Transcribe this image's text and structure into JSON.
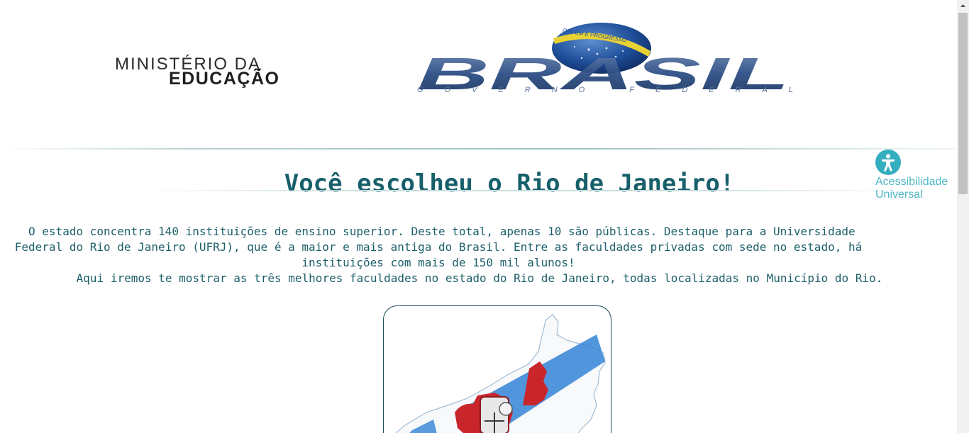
{
  "header": {
    "ministry_line1": "MINISTÉRIO DA",
    "ministry_line2": "EDUCAÇÃO",
    "gov_logo_word": "BRASIL",
    "gov_logo_tagline": "GOVERNO FEDERAL",
    "gov_logo_band": "ORDEM E PROGRESSO"
  },
  "title": "Você escolheu o Rio de Janeiro!",
  "accessibility": {
    "label_line1": "Acessibilidade",
    "label_line2": "Universal",
    "icon": "accessibility-person-icon"
  },
  "intro": {
    "line1": " O estado concentra 140 instituições de ensino superior. Deste total, apenas 10 são públicas. Destaque para a Universidade",
    "line2": "Federal do Rio de Janeiro (UFRJ), que é a maior e mais antiga do Brasil. Entre as faculdades privadas com sede no estado, há",
    "line3": "instituições com mais de 150 mil alunos!",
    "line4": "Aqui iremos te mostrar as três melhores faculdades no estado do Rio de Janeiro, todas localizadas no Município do Rio."
  },
  "map_image": {
    "subject": "rio-de-janeiro-state-map-with-coat-of-arms"
  },
  "colors": {
    "accent_text": "#17606b",
    "body_text": "#1c5f69",
    "accessibility": "#35aebf",
    "card_border": "#1a4f5a"
  }
}
